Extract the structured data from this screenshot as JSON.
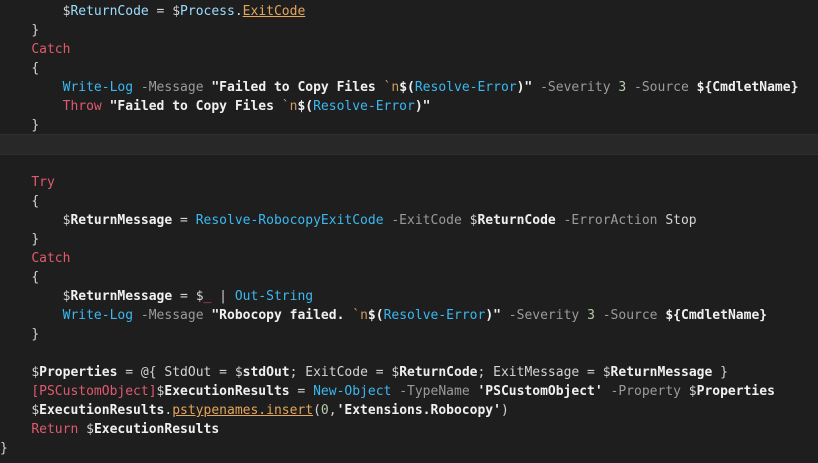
{
  "editor": {
    "lines": [
      [
        {
          "t": "ws",
          "v": "        "
        },
        {
          "t": "dollar",
          "v": "$"
        },
        {
          "t": "var",
          "v": "ReturnCode"
        },
        {
          "t": "op",
          "v": " = "
        },
        {
          "t": "dollar",
          "v": "$"
        },
        {
          "t": "var",
          "v": "Process"
        },
        {
          "t": "punct",
          "v": "."
        },
        {
          "t": "prop",
          "v": "ExitCode"
        }
      ],
      [
        {
          "t": "ws",
          "v": "    "
        },
        {
          "t": "punct",
          "v": "}"
        }
      ],
      [
        {
          "t": "ws",
          "v": "    "
        },
        {
          "t": "kw",
          "v": "Catch"
        }
      ],
      [
        {
          "t": "ws",
          "v": "    "
        },
        {
          "t": "punct",
          "v": "{"
        }
      ],
      [
        {
          "t": "ws",
          "v": "        "
        },
        {
          "t": "cmd",
          "v": "Write-Log"
        },
        {
          "t": "param",
          "v": " -Message "
        },
        {
          "t": "strbold",
          "v": "\"Failed to Copy Files "
        },
        {
          "t": "esc",
          "v": "`n"
        },
        {
          "t": "strbold",
          "v": "$("
        },
        {
          "t": "fn",
          "v": "Resolve-Error"
        },
        {
          "t": "strbold",
          "v": ")\""
        },
        {
          "t": "param",
          "v": " -Severity "
        },
        {
          "t": "num",
          "v": "3"
        },
        {
          "t": "param",
          "v": " -Source "
        },
        {
          "t": "strbold",
          "v": "${"
        },
        {
          "t": "bold",
          "v": "CmdletName"
        },
        {
          "t": "strbold",
          "v": "}"
        }
      ],
      [
        {
          "t": "ws",
          "v": "        "
        },
        {
          "t": "kw",
          "v": "Throw"
        },
        {
          "t": "plain",
          "v": " "
        },
        {
          "t": "strbold",
          "v": "\"Failed to Copy Files "
        },
        {
          "t": "esc",
          "v": "`n"
        },
        {
          "t": "strbold",
          "v": "$("
        },
        {
          "t": "fn",
          "v": "Resolve-Error"
        },
        {
          "t": "strbold",
          "v": ")\""
        }
      ],
      [
        {
          "t": "ws",
          "v": "    "
        },
        {
          "t": "punct",
          "v": "}"
        }
      ],
      [],
      [],
      [
        {
          "t": "ws",
          "v": "    "
        },
        {
          "t": "kw",
          "v": "Try"
        }
      ],
      [
        {
          "t": "ws",
          "v": "    "
        },
        {
          "t": "punct",
          "v": "{"
        }
      ],
      [
        {
          "t": "ws",
          "v": "        "
        },
        {
          "t": "dollar",
          "v": "$"
        },
        {
          "t": "bold",
          "v": "ReturnMessage"
        },
        {
          "t": "op",
          "v": " = "
        },
        {
          "t": "cmd",
          "v": "Resolve-RobocopyExitCode"
        },
        {
          "t": "param",
          "v": " -ExitCode "
        },
        {
          "t": "dollar",
          "v": "$"
        },
        {
          "t": "bold",
          "v": "ReturnCode"
        },
        {
          "t": "param",
          "v": " -ErrorAction "
        },
        {
          "t": "plain",
          "v": "Stop"
        }
      ],
      [
        {
          "t": "ws",
          "v": "    "
        },
        {
          "t": "punct",
          "v": "}"
        }
      ],
      [
        {
          "t": "ws",
          "v": "    "
        },
        {
          "t": "kw",
          "v": "Catch"
        }
      ],
      [
        {
          "t": "ws",
          "v": "    "
        },
        {
          "t": "punct",
          "v": "{"
        }
      ],
      [
        {
          "t": "ws",
          "v": "        "
        },
        {
          "t": "dollar",
          "v": "$"
        },
        {
          "t": "bold",
          "v": "ReturnMessage"
        },
        {
          "t": "op",
          "v": " = "
        },
        {
          "t": "dollar",
          "v": "$"
        },
        {
          "t": "kw",
          "v": "_"
        },
        {
          "t": "op",
          "v": " | "
        },
        {
          "t": "cmd",
          "v": "Out-String"
        }
      ],
      [
        {
          "t": "ws",
          "v": "        "
        },
        {
          "t": "cmd",
          "v": "Write-Log"
        },
        {
          "t": "param",
          "v": " -Message "
        },
        {
          "t": "strbold",
          "v": "\"Robocopy failed. "
        },
        {
          "t": "esc",
          "v": "`n"
        },
        {
          "t": "strbold",
          "v": "$("
        },
        {
          "t": "fn",
          "v": "Resolve-Error"
        },
        {
          "t": "strbold",
          "v": ")\""
        },
        {
          "t": "param",
          "v": " -Severity "
        },
        {
          "t": "num",
          "v": "3"
        },
        {
          "t": "param",
          "v": " -Source "
        },
        {
          "t": "strbold",
          "v": "${"
        },
        {
          "t": "bold",
          "v": "CmdletName"
        },
        {
          "t": "strbold",
          "v": "}"
        }
      ],
      [
        {
          "t": "ws",
          "v": "    "
        },
        {
          "t": "punct",
          "v": "}"
        }
      ],
      [],
      [
        {
          "t": "ws",
          "v": "    "
        },
        {
          "t": "dollar",
          "v": "$"
        },
        {
          "t": "bold",
          "v": "Properties"
        },
        {
          "t": "op",
          "v": " = "
        },
        {
          "t": "plain",
          "v": "@{ StdOut = "
        },
        {
          "t": "dollar",
          "v": "$"
        },
        {
          "t": "bold",
          "v": "stdOut"
        },
        {
          "t": "plain",
          "v": "; ExitCode = "
        },
        {
          "t": "dollar",
          "v": "$"
        },
        {
          "t": "bold",
          "v": "ReturnCode"
        },
        {
          "t": "plain",
          "v": "; ExitMessage = "
        },
        {
          "t": "dollar",
          "v": "$"
        },
        {
          "t": "bold",
          "v": "ReturnMessage"
        },
        {
          "t": "plain",
          "v": " }"
        }
      ],
      [
        {
          "t": "ws",
          "v": "    "
        },
        {
          "t": "type",
          "v": "[PSCustomObject]"
        },
        {
          "t": "dollar",
          "v": "$"
        },
        {
          "t": "bold",
          "v": "ExecutionResults"
        },
        {
          "t": "op",
          "v": " = "
        },
        {
          "t": "cmd",
          "v": "New-Object"
        },
        {
          "t": "param",
          "v": " -TypeName "
        },
        {
          "t": "strbold",
          "v": "'PSCustomObject'"
        },
        {
          "t": "param",
          "v": " -Property "
        },
        {
          "t": "dollar",
          "v": "$"
        },
        {
          "t": "bold",
          "v": "Properties"
        }
      ],
      [
        {
          "t": "ws",
          "v": "    "
        },
        {
          "t": "dollar",
          "v": "$"
        },
        {
          "t": "bold",
          "v": "ExecutionResults"
        },
        {
          "t": "punct",
          "v": "."
        },
        {
          "t": "prop",
          "v": "pstypenames.insert"
        },
        {
          "t": "plain",
          "v": "("
        },
        {
          "t": "num",
          "v": "0"
        },
        {
          "t": "plain",
          "v": ","
        },
        {
          "t": "strbold",
          "v": "'Extensions.Robocopy'"
        },
        {
          "t": "plain",
          "v": ")"
        }
      ],
      [
        {
          "t": "ws",
          "v": "    "
        },
        {
          "t": "ret",
          "v": "Return"
        },
        {
          "t": "plain",
          "v": " "
        },
        {
          "t": "dollar",
          "v": "$"
        },
        {
          "t": "bold",
          "v": "ExecutionResults"
        }
      ],
      [
        {
          "t": "punct",
          "v": "}"
        }
      ]
    ],
    "current_line_index": 7
  }
}
